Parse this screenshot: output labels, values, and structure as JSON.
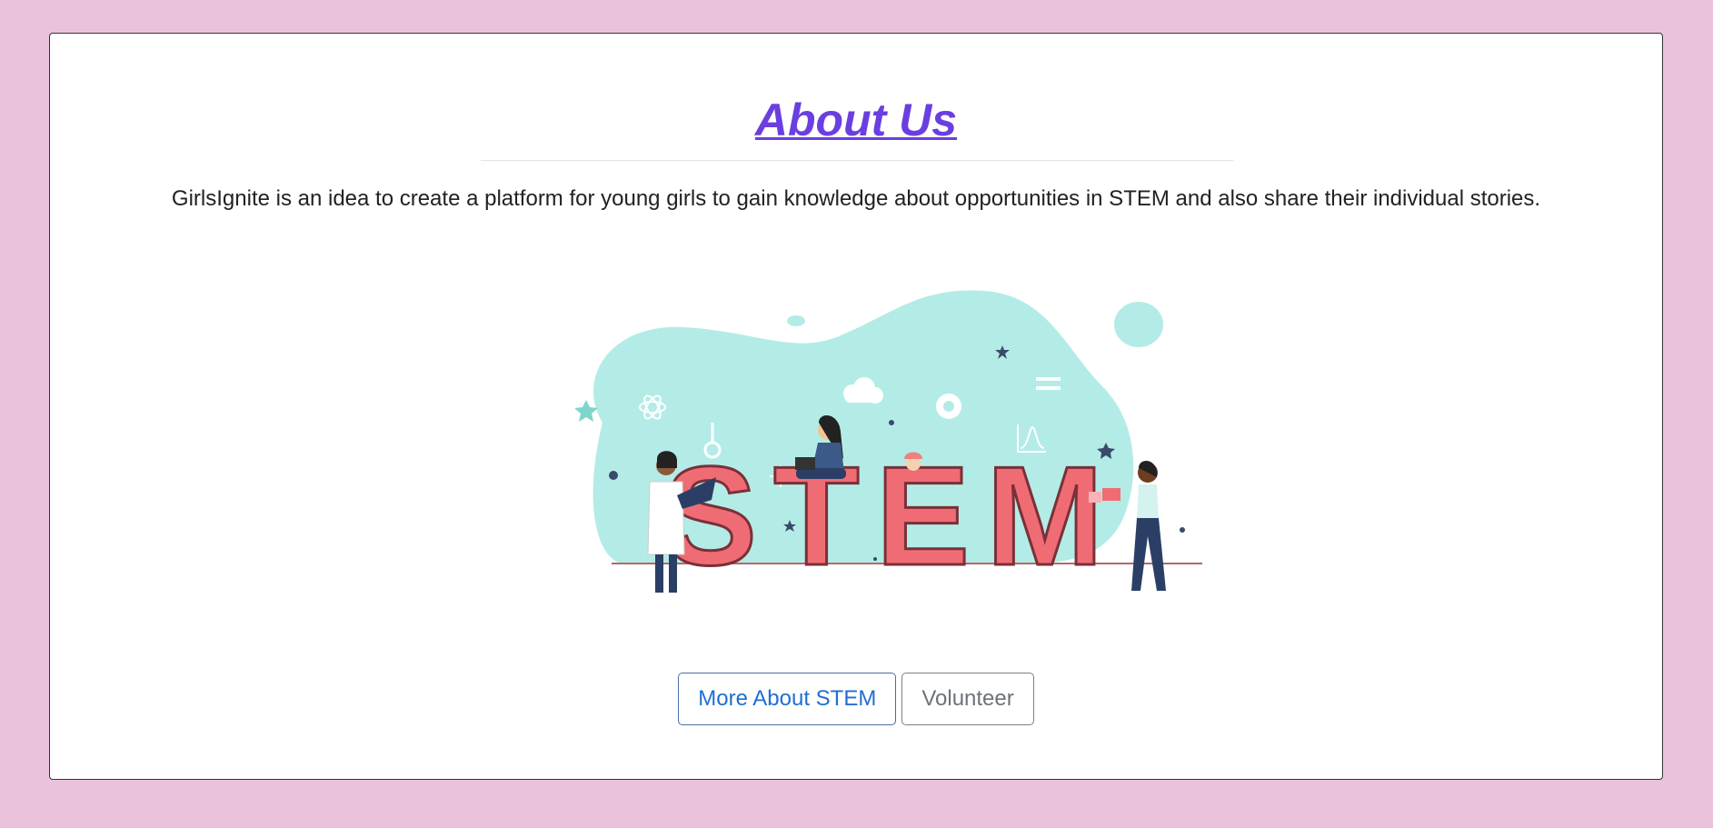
{
  "about": {
    "title": "About Us",
    "description": "GirlsIgnite is an idea to create a platform for young girls to gain knowledge about opportunities in STEM and also share their individual stories."
  },
  "illustration": {
    "text": "STEM",
    "alt": "STEM illustration with women scientists"
  },
  "buttons": {
    "more_about_stem": "More About STEM",
    "volunteer": "Volunteer"
  },
  "colors": {
    "page_background": "#ebc2dc",
    "title": "#6a3fe0",
    "blob": "#b3ece6",
    "letters": "#f06c74",
    "primary_button_text": "#1f6fd1",
    "secondary_button_text": "#6c737a"
  }
}
